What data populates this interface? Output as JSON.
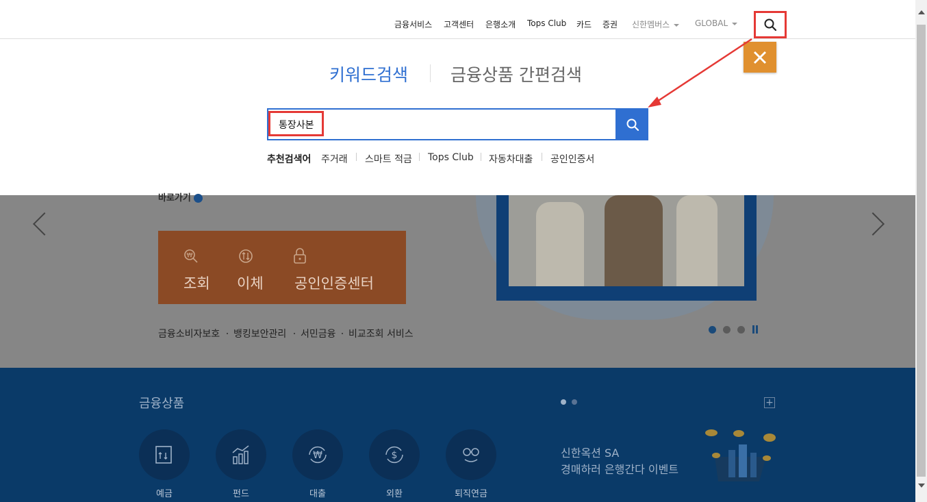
{
  "top_nav": {
    "items": [
      "금융서비스",
      "고객센터",
      "은행소개",
      "Tops Club",
      "카드",
      "증권"
    ],
    "members_label": "신한멤버스",
    "global_label": "GLOBAL"
  },
  "search_panel": {
    "tab_keyword": "키워드검색",
    "tab_product": "금융상품 간편검색",
    "input_value": "통장사본",
    "recommended_label": "추천검색어",
    "recommended": [
      "주거래",
      "스마트 적금",
      "Tops Club",
      "자동차대출",
      "공인인증서"
    ]
  },
  "hero": {
    "goto_label": "바로가기",
    "quick_buttons": [
      "조회",
      "이체",
      "공인인증센터"
    ],
    "links": [
      "금융소비자보호",
      "뱅킹보안관리",
      "서민금융",
      "비교조회 서비스"
    ]
  },
  "products": {
    "title": "금융상품",
    "items": [
      "예금",
      "펀드",
      "대출",
      "외환",
      "퇴직연금"
    ],
    "event_line1": "신한옥션 SA",
    "event_line2": "경매하러 은행간다 이벤트",
    "plus_symbol": "+"
  },
  "colors": {
    "accent_blue": "#2f6fd1",
    "annotation_red": "#e53935",
    "close_orange": "#e0902f",
    "products_bg": "#0a3a68"
  }
}
